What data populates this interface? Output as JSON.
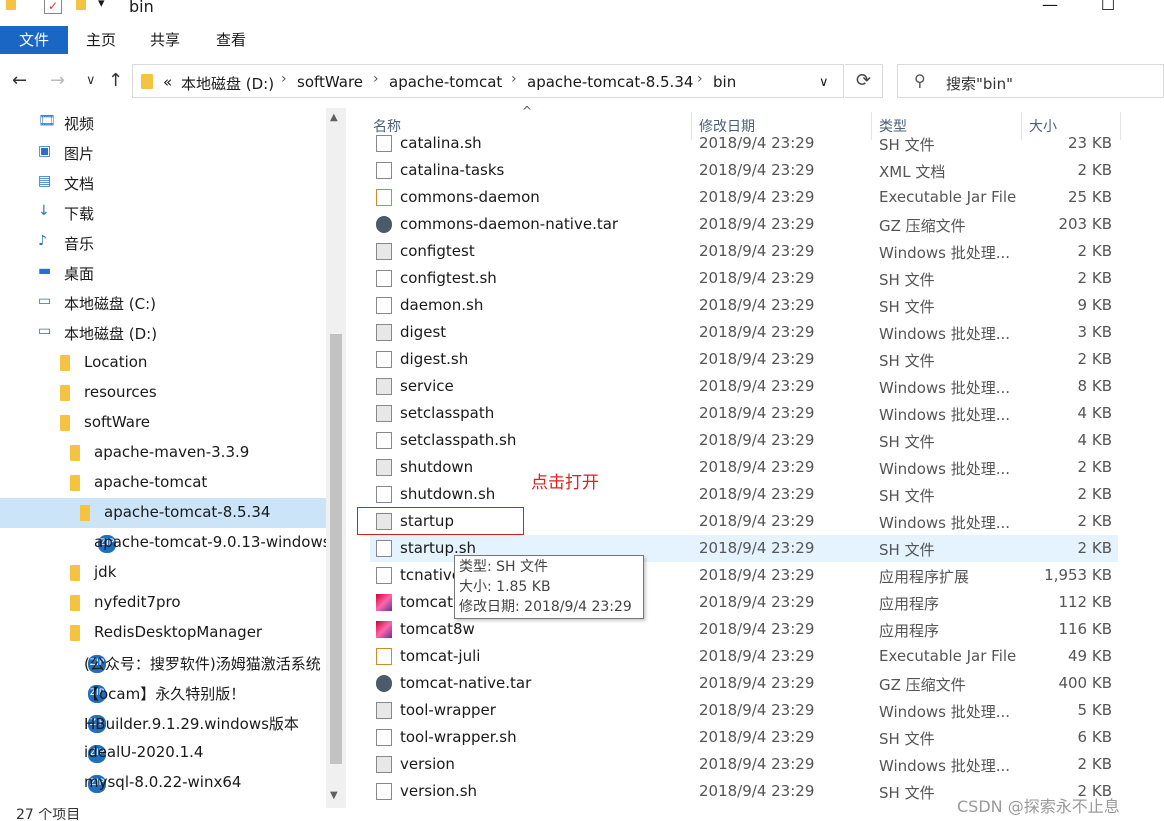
{
  "window": {
    "title": "bin",
    "minimize_glyph": "—",
    "maximize_glyph": "☐",
    "qa_folder_icon": "folder-icon",
    "qa_check_icon": "properties-icon",
    "qa_dropdown_glyph": "▾"
  },
  "ribbon": {
    "tabs": [
      "文件",
      "主页",
      "共享",
      "查看"
    ]
  },
  "nav": {
    "back": "←",
    "forward": "→",
    "recent": "∨",
    "up": "↑",
    "refresh": "⟳",
    "address_chevron": "∨",
    "breadcrumbs": [
      "«",
      "本地磁盘 (D:)",
      "softWare",
      "apache-tomcat",
      "apache-tomcat-8.5.34",
      "bin"
    ],
    "separator": "›"
  },
  "search": {
    "placeholder": "搜索\"bin\"",
    "icon": "search-icon"
  },
  "sidebar": {
    "items": [
      {
        "label": "视频",
        "icon": "video-icon"
      },
      {
        "label": "图片",
        "icon": "pictures-icon"
      },
      {
        "label": "文档",
        "icon": "documents-icon"
      },
      {
        "label": "下载",
        "icon": "download-icon"
      },
      {
        "label": "音乐",
        "icon": "music-icon"
      },
      {
        "label": "桌面",
        "icon": "desktop-icon"
      },
      {
        "label": "本地磁盘 (C:)",
        "icon": "drive-icon"
      },
      {
        "label": "本地磁盘 (D:)",
        "icon": "drive-icon"
      },
      {
        "label": "Location",
        "icon": "folder-icon"
      },
      {
        "label": "resources",
        "icon": "folder-icon"
      },
      {
        "label": "softWare",
        "icon": "folder-icon"
      },
      {
        "label": "apache-maven-3.3.9",
        "icon": "folder-icon"
      },
      {
        "label": "apache-tomcat",
        "icon": "folder-icon"
      },
      {
        "label": "apache-tomcat-8.5.34",
        "icon": "folder-icon"
      },
      {
        "label": "apache-tomcat-9.0.13-windows-",
        "icon": "zip-icon"
      },
      {
        "label": "jdk",
        "icon": "folder-icon"
      },
      {
        "label": "nyfedit7pro",
        "icon": "folder-icon"
      },
      {
        "label": "RedisDesktopManager",
        "icon": "folder-icon"
      },
      {
        "label": "(公众号：搜罗软件)汤姆猫激活系统",
        "icon": "zip-icon"
      },
      {
        "label": "【ocam】永久特别版！",
        "icon": "zip-icon"
      },
      {
        "label": "HBuilder.9.1.29.windows版本",
        "icon": "zip-icon"
      },
      {
        "label": "idealU-2020.1.4",
        "icon": "zip-icon"
      },
      {
        "label": "mysql-8.0.22-winx64",
        "icon": "zip-icon"
      }
    ],
    "selected_index": 13
  },
  "columns": {
    "name": "名称",
    "date": "修改日期",
    "type": "类型",
    "size": "大小",
    "sort_glyph": "^"
  },
  "files": [
    {
      "name": "catalina.sh",
      "date": "2018/9/4 23:29",
      "type": "SH 文件",
      "size": "23 KB",
      "icon": "sh"
    },
    {
      "name": "catalina-tasks",
      "date": "2018/9/4 23:29",
      "type": "XML 文档",
      "size": "2 KB",
      "icon": "xml"
    },
    {
      "name": "commons-daemon",
      "date": "2018/9/4 23:29",
      "type": "Executable Jar File",
      "size": "25 KB",
      "icon": "jar"
    },
    {
      "name": "commons-daemon-native.tar",
      "date": "2018/9/4 23:29",
      "type": "GZ 压缩文件",
      "size": "203 KB",
      "icon": "tar"
    },
    {
      "name": "configtest",
      "date": "2018/9/4 23:29",
      "type": "Windows 批处理...",
      "size": "2 KB",
      "icon": "bat"
    },
    {
      "name": "configtest.sh",
      "date": "2018/9/4 23:29",
      "type": "SH 文件",
      "size": "2 KB",
      "icon": "sh"
    },
    {
      "name": "daemon.sh",
      "date": "2018/9/4 23:29",
      "type": "SH 文件",
      "size": "9 KB",
      "icon": "sh"
    },
    {
      "name": "digest",
      "date": "2018/9/4 23:29",
      "type": "Windows 批处理...",
      "size": "3 KB",
      "icon": "bat"
    },
    {
      "name": "digest.sh",
      "date": "2018/9/4 23:29",
      "type": "SH 文件",
      "size": "2 KB",
      "icon": "sh"
    },
    {
      "name": "service",
      "date": "2018/9/4 23:29",
      "type": "Windows 批处理...",
      "size": "8 KB",
      "icon": "bat"
    },
    {
      "name": "setclasspath",
      "date": "2018/9/4 23:29",
      "type": "Windows 批处理...",
      "size": "4 KB",
      "icon": "bat"
    },
    {
      "name": "setclasspath.sh",
      "date": "2018/9/4 23:29",
      "type": "SH 文件",
      "size": "4 KB",
      "icon": "sh"
    },
    {
      "name": "shutdown",
      "date": "2018/9/4 23:29",
      "type": "Windows 批处理...",
      "size": "2 KB",
      "icon": "bat"
    },
    {
      "name": "shutdown.sh",
      "date": "2018/9/4 23:29",
      "type": "SH 文件",
      "size": "2 KB",
      "icon": "sh"
    },
    {
      "name": "startup",
      "date": "2018/9/4 23:29",
      "type": "Windows 批处理...",
      "size": "2 KB",
      "icon": "bat"
    },
    {
      "name": "startup.sh",
      "date": "2018/9/4 23:29",
      "type": "SH 文件",
      "size": "2 KB",
      "icon": "sh"
    },
    {
      "name": "tcnative",
      "date": "2018/9/4 23:29",
      "type": "应用程序扩展",
      "size": "1,953 KB",
      "icon": "dll"
    },
    {
      "name": "tomcat",
      "date": "2018/9/4 23:29",
      "type": "应用程序",
      "size": "112 KB",
      "icon": "exe"
    },
    {
      "name": "tomcat8w",
      "date": "2018/9/4 23:29",
      "type": "应用程序",
      "size": "116 KB",
      "icon": "exe"
    },
    {
      "name": "tomcat-juli",
      "date": "2018/9/4 23:29",
      "type": "Executable Jar File",
      "size": "49 KB",
      "icon": "jar"
    },
    {
      "name": "tomcat-native.tar",
      "date": "2018/9/4 23:29",
      "type": "GZ 压缩文件",
      "size": "400 KB",
      "icon": "tar"
    },
    {
      "name": "tool-wrapper",
      "date": "2018/9/4 23:29",
      "type": "Windows 批处理...",
      "size": "5 KB",
      "icon": "bat"
    },
    {
      "name": "tool-wrapper.sh",
      "date": "2018/9/4 23:29",
      "type": "SH 文件",
      "size": "6 KB",
      "icon": "sh"
    },
    {
      "name": "version",
      "date": "2018/9/4 23:29",
      "type": "Windows 批处理...",
      "size": "2 KB",
      "icon": "bat"
    },
    {
      "name": "version.sh",
      "date": "2018/9/4 23:29",
      "type": "SH 文件",
      "size": "2 KB",
      "icon": "sh"
    }
  ],
  "hover_index": 15,
  "annotation": "点击打开",
  "tooltip": {
    "type": "类型: SH 文件",
    "size": "大小: 1.85 KB",
    "modified": "修改日期: 2018/9/4 23:29"
  },
  "status": {
    "count": "27 个项目"
  },
  "watermark": "CSDN @探索永不止息",
  "colors": {
    "accent": "#1a66c4",
    "selection": "#cce4f7",
    "hover": "#e5f3ff",
    "annotation_red": "#d81e1e",
    "folder": "#f5c242"
  }
}
